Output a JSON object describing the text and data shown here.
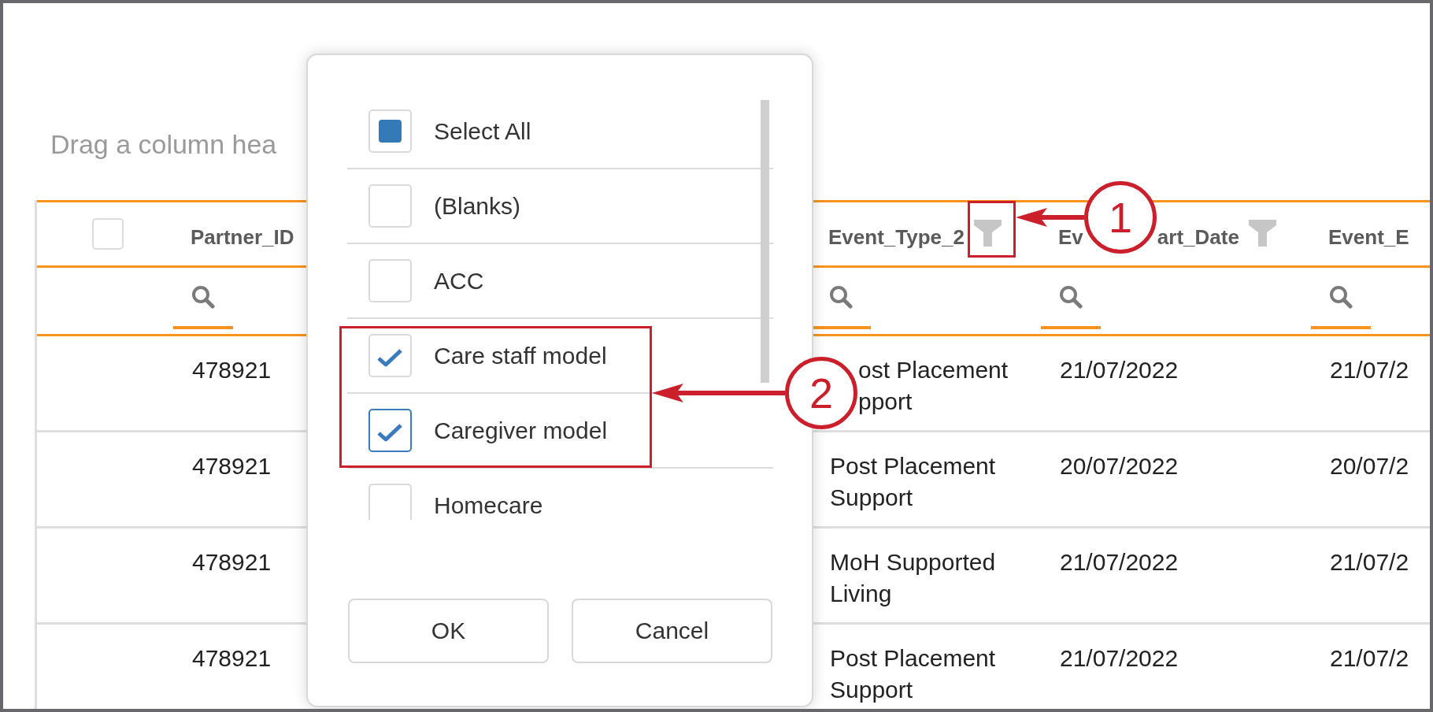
{
  "group_panel": {
    "hint": "Drag a column hea"
  },
  "grid": {
    "select_all_checked": false,
    "columns": [
      {
        "kind": "text",
        "label": "Partner_ID",
        "filter": false
      },
      {
        "kind": "text",
        "label": "Event_Type_2",
        "filter": true
      },
      {
        "kind": "covered",
        "pieces": [
          "Ev",
          "art_Date"
        ],
        "filter": true
      },
      {
        "kind": "text",
        "label": "Event_E",
        "filter": false
      }
    ],
    "rows": [
      {
        "cells": [
          {
            "kind": "text",
            "text": "478921"
          },
          {
            "kind": "covered",
            "pieces": [
              "ost Placement",
              "pport"
            ]
          },
          {
            "kind": "text",
            "text": "21/07/2022"
          },
          {
            "kind": "text",
            "text": "21/07/2"
          }
        ]
      },
      {
        "cells": [
          {
            "kind": "text",
            "text": "478921"
          },
          {
            "kind": "text",
            "text": "Post Placement Support"
          },
          {
            "kind": "text",
            "text": "20/07/2022"
          },
          {
            "kind": "text",
            "text": "20/07/2"
          }
        ]
      },
      {
        "cells": [
          {
            "kind": "text",
            "text": "478921"
          },
          {
            "kind": "text",
            "text": "MoH Supported Living"
          },
          {
            "kind": "text",
            "text": "21/07/2022"
          },
          {
            "kind": "text",
            "text": "21/07/2"
          }
        ]
      },
      {
        "cells": [
          {
            "kind": "text",
            "text": "478921"
          },
          {
            "kind": "text",
            "text": "Post Placement Support"
          },
          {
            "kind": "text",
            "text": "21/07/2022"
          },
          {
            "kind": "text",
            "text": "21/07/2"
          }
        ]
      }
    ]
  },
  "filter_popup": {
    "items": [
      {
        "label": "Select All",
        "checked": false,
        "indeterminate": true,
        "focused": false
      },
      {
        "label": "(Blanks)",
        "checked": false,
        "indeterminate": false,
        "focused": false
      },
      {
        "label": "ACC",
        "checked": false,
        "indeterminate": false,
        "focused": false
      },
      {
        "label": "Care staff model",
        "checked": true,
        "indeterminate": false,
        "focused": false
      },
      {
        "label": "Caregiver model",
        "checked": true,
        "indeterminate": false,
        "focused": true
      },
      {
        "label": "Homecare",
        "checked": false,
        "indeterminate": false,
        "focused": false
      }
    ],
    "buttons": [
      "OK",
      "Cancel"
    ]
  },
  "annotations": [
    {
      "number": "1"
    },
    {
      "number": "2"
    }
  ]
}
